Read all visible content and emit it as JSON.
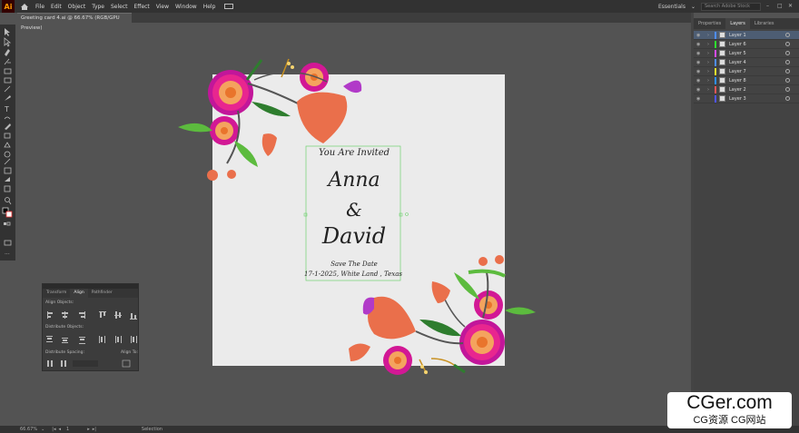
{
  "menubar": {
    "logo": "Ai",
    "items": [
      "File",
      "Edit",
      "Object",
      "Type",
      "Select",
      "Effect",
      "View",
      "Window",
      "Help"
    ],
    "workspace": "Essentials",
    "search_placeholder": "Search Adobe Stock"
  },
  "document": {
    "tab_title": "Greeting card 4.ai @ 66.67% (RGB/GPU Preview)"
  },
  "panel": {
    "tabs": [
      "Properties",
      "Layers",
      "Libraries"
    ],
    "layers": [
      {
        "name": "Layer 1",
        "color": "#4f8df5",
        "selected": true
      },
      {
        "name": "Layer 6",
        "color": "#2ee02e",
        "selected": false
      },
      {
        "name": "Layer 5",
        "color": "#d54cff",
        "selected": false
      },
      {
        "name": "Layer 4",
        "color": "#4f8df5",
        "selected": false
      },
      {
        "name": "Layer 7",
        "color": "#e0e02e",
        "selected": false
      },
      {
        "name": "Layer 8",
        "color": "#2e8fff",
        "selected": false
      },
      {
        "name": "Layer 2",
        "color": "#e05555",
        "selected": false
      },
      {
        "name": "Layer 3",
        "color": "#4f55f5",
        "selected": false
      }
    ]
  },
  "align_panel": {
    "tabs": [
      "Transform",
      "Align",
      "Pathfinder"
    ],
    "align_objects": "Align Objects:",
    "distribute_objects": "Distribute Objects:",
    "distribute_spacing": "Distribute Spacing:",
    "align_to": "Align To:"
  },
  "card": {
    "heading": "You Are Invited",
    "name1": "Anna",
    "amp": "&",
    "name2": "David",
    "save": "Save The Date",
    "details": "17-1-2025, White Land , Texas"
  },
  "status": {
    "zoom": "66.67%",
    "page": "1",
    "tool": "Selection"
  },
  "watermark": {
    "line1": "CGer.com",
    "line2": "CG资源  CG网站"
  }
}
